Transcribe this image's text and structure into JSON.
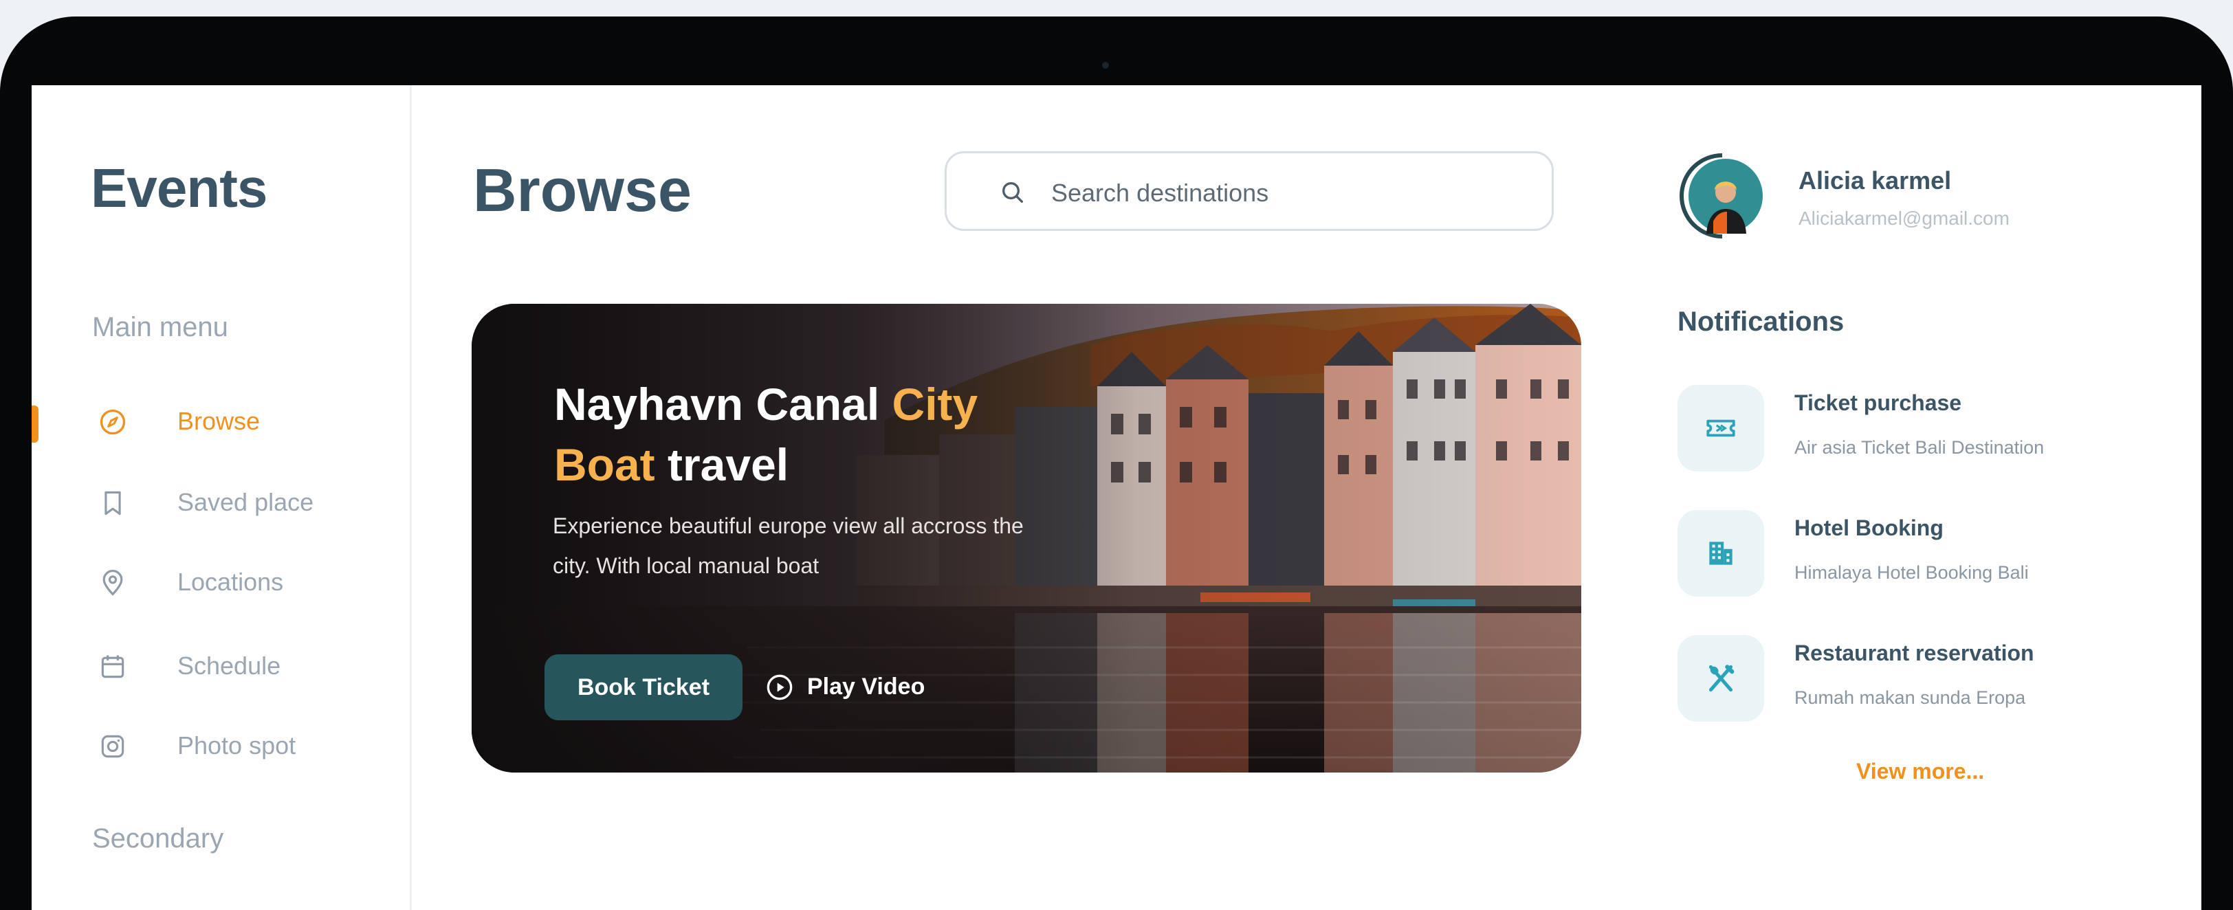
{
  "app": {
    "logo": "Events"
  },
  "sidebar": {
    "main_menu_title": "Main menu",
    "items": [
      {
        "label": "Browse",
        "icon": "compass-icon",
        "active": true
      },
      {
        "label": "Saved place",
        "icon": "bookmark-icon",
        "active": false
      },
      {
        "label": "Locations",
        "icon": "map-pin-icon",
        "active": false
      },
      {
        "label": "Schedule",
        "icon": "calendar-icon",
        "active": false
      },
      {
        "label": "Photo spot",
        "icon": "camera-icon",
        "active": false
      }
    ],
    "secondary_title": "Secondary"
  },
  "main": {
    "title": "Browse",
    "search": {
      "placeholder": "Search destinations",
      "value": ""
    },
    "hero": {
      "title_part1": "Nayhavn Canal ",
      "title_accent1": "City",
      "title_accent2": "Boat",
      "title_part2": " travel",
      "description": "Experience beautiful europe view all accross the city. With local manual boat",
      "book_button": "Book Ticket",
      "play_button": "Play Video"
    }
  },
  "profile": {
    "name": "Alicia karmel",
    "email": "Aliciakarmel@gmail.com"
  },
  "notifications": {
    "title": "Notifications",
    "items": [
      {
        "title": "Ticket purchase",
        "subtitle": "Air asia Ticket Bali Destination",
        "icon": "ticket-icon"
      },
      {
        "title": "Hotel Booking",
        "subtitle": "Himalaya Hotel Booking Bali",
        "icon": "building-icon"
      },
      {
        "title": "Restaurant reservation",
        "subtitle": "Rumah makan sunda Eropa",
        "icon": "utensils-icon"
      }
    ],
    "view_more": "View more..."
  },
  "colors": {
    "accent": "#f0911d",
    "primary_text": "#3b5566",
    "muted_text": "#9aa6b1",
    "button_teal": "#26565c",
    "hero_accent": "#f7b14f"
  }
}
